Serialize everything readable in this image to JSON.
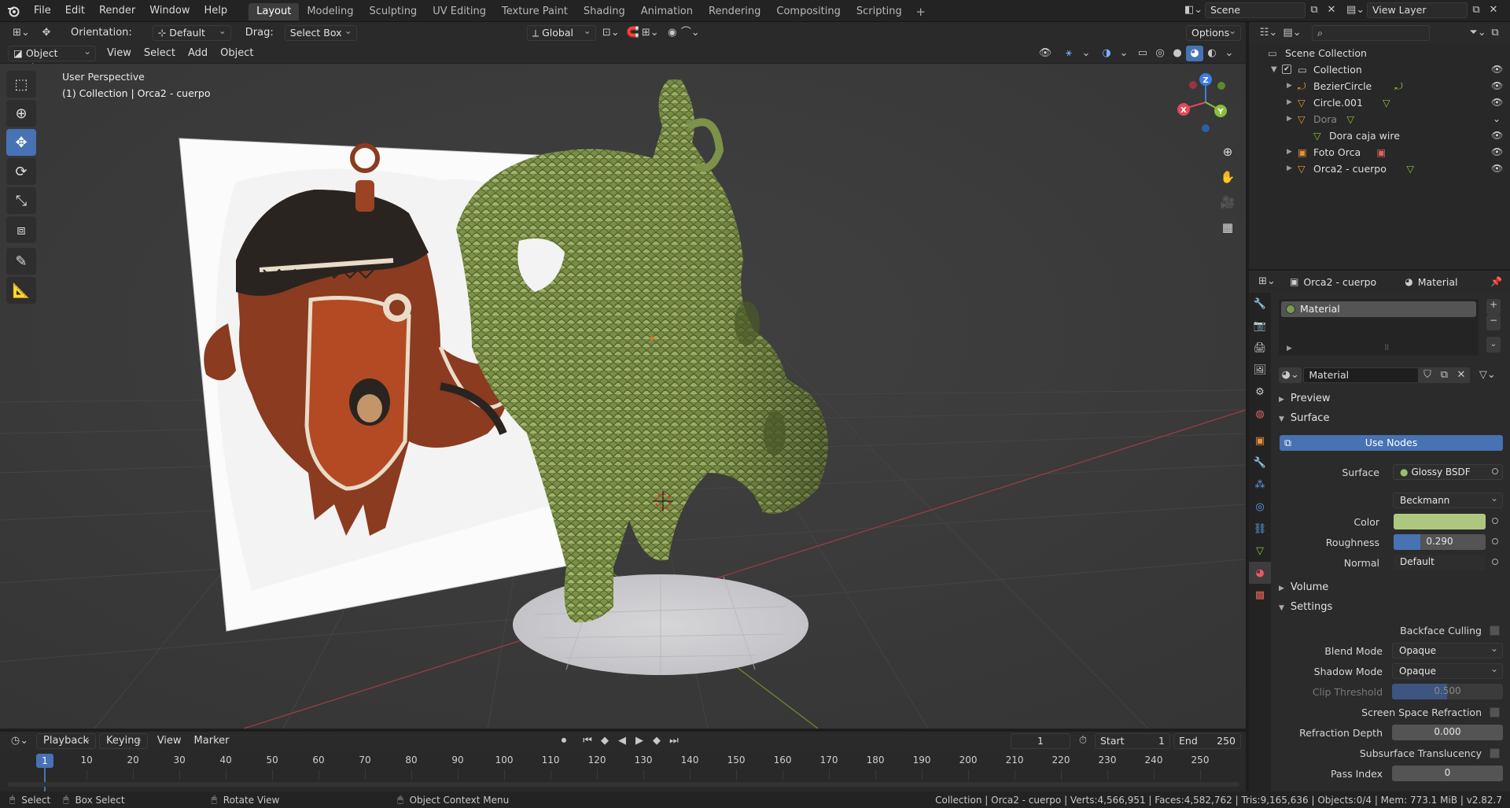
{
  "topbar": {
    "menus": [
      "File",
      "Edit",
      "Render",
      "Window",
      "Help"
    ],
    "workspaces": [
      "Layout",
      "Modeling",
      "Sculpting",
      "UV Editing",
      "Texture Paint",
      "Shading",
      "Animation",
      "Rendering",
      "Compositing",
      "Scripting"
    ],
    "active_workspace": "Layout",
    "scene": "Scene",
    "view_layer": "View Layer"
  },
  "tool_header": {
    "orientation_label": "Orientation:",
    "orientation_value": "Default",
    "drag_label": "Drag:",
    "drag_value": "Select Box",
    "transform_orientation": "Global",
    "options": "Options"
  },
  "viewport_header": {
    "mode": "Object Mode",
    "menus": [
      "View",
      "Select",
      "Add",
      "Object"
    ]
  },
  "viewport": {
    "perspective": "User Perspective",
    "collection_info": "(1) Collection | Orca2 - cuerpo",
    "gizmo": {
      "x": "X",
      "y": "Y",
      "z": "Z"
    }
  },
  "outliner": {
    "root": "Scene Collection",
    "collection": "Collection",
    "items": [
      {
        "name": "BezierCircle",
        "type": "curve"
      },
      {
        "name": "Circle.001",
        "type": "mesh"
      },
      {
        "name": "Dora",
        "type": "mesh",
        "disabled": true
      },
      {
        "name": "Dora caja wire",
        "type": "mesh",
        "child": true
      },
      {
        "name": "Foto Orca",
        "type": "image"
      },
      {
        "name": "Orca2 - cuerpo",
        "type": "mesh"
      }
    ]
  },
  "properties": {
    "object_name": "Orca2 - cuerpo",
    "context": "Material",
    "slot_name": "Material",
    "material_name": "Material",
    "panels": {
      "preview": "Preview",
      "surface": "Surface",
      "volume": "Volume",
      "settings": "Settings"
    },
    "use_nodes": "Use Nodes",
    "surface_label": "Surface",
    "surface_value": "Glossy BSDF",
    "distribution": "Beckmann",
    "color_label": "Color",
    "color_value": "#aec77f",
    "roughness_label": "Roughness",
    "roughness_value": "0.290",
    "roughness_fraction": 0.29,
    "normal_label": "Normal",
    "normal_value": "Default",
    "backface_culling": "Backface Culling",
    "blend_mode_label": "Blend Mode",
    "blend_mode_value": "Opaque",
    "shadow_mode_label": "Shadow Mode",
    "shadow_mode_value": "Opaque",
    "clip_threshold_label": "Clip Threshold",
    "clip_threshold_value": "0.500",
    "ssr": "Screen Space Refraction",
    "refraction_depth_label": "Refraction Depth",
    "refraction_depth_value": "0.000",
    "subsurface": "Subsurface Translucency",
    "pass_index_label": "Pass Index",
    "pass_index_value": "0"
  },
  "timeline": {
    "menus": [
      "Playback",
      "Keying",
      "View",
      "Marker"
    ],
    "current_frame": "1",
    "start_label": "Start",
    "start_value": "1",
    "end_label": "End",
    "end_value": "250",
    "ticks": [
      "1",
      "10",
      "20",
      "30",
      "40",
      "50",
      "60",
      "70",
      "80",
      "90",
      "100",
      "110",
      "120",
      "130",
      "140",
      "150",
      "160",
      "170",
      "180",
      "190",
      "200",
      "210",
      "220",
      "230",
      "240",
      "250"
    ]
  },
  "statusbar": {
    "select": "Select",
    "box_select": "Box Select",
    "rotate_view": "Rotate View",
    "context_menu": "Object Context Menu",
    "stats": "Collection | Orca2 - cuerpo | Verts:4,566,951 | Faces:4,582,762 | Tris:9,165,636 | Objects:0/4 | Mem: 773.1 MiB | v2.82.7"
  }
}
